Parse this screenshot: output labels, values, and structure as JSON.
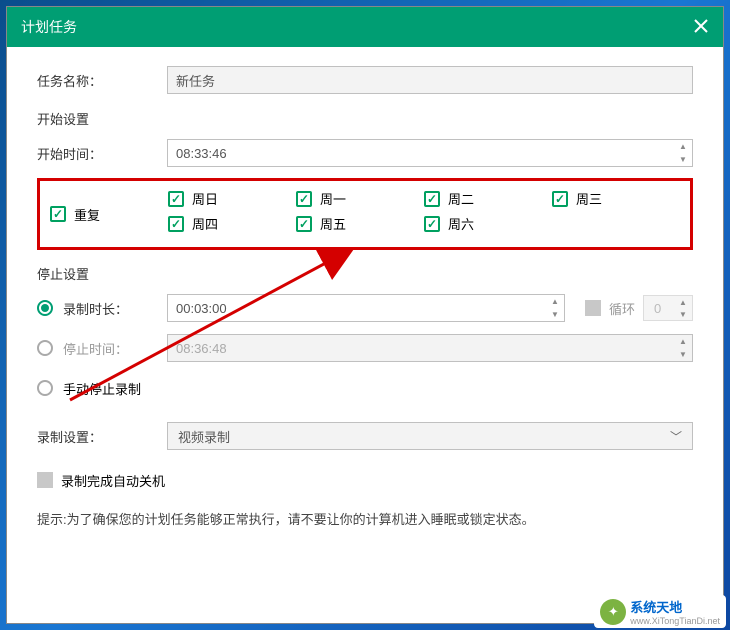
{
  "title": "计划任务",
  "fields": {
    "task_name_label": "任务名称：",
    "task_name_value": "新任务",
    "start_settings": "开始设置",
    "start_time_label": "开始时间：",
    "start_time_value": "08:33:46",
    "repeat_label": "重复",
    "days": [
      "周日",
      "周一",
      "周二",
      "周三",
      "周四",
      "周五",
      "周六"
    ],
    "stop_settings": "停止设置",
    "duration_label": "录制时长：",
    "duration_value": "00:03:00",
    "loop_label": "循环",
    "loop_value": "0",
    "stop_time_label": "停止时间：",
    "stop_time_value": "08:36:48",
    "manual_stop_label": "手动停止录制",
    "record_settings_label": "录制设置：",
    "record_mode_value": "视频录制",
    "shutdown_label": "录制完成自动关机",
    "hint": "提示:为了确保您的计划任务能够正常执行，请不要让你的计算机进入睡眠或锁定状态。"
  },
  "watermark": {
    "brand": "系统天地",
    "url": "www.XiTongTianDi.net"
  }
}
